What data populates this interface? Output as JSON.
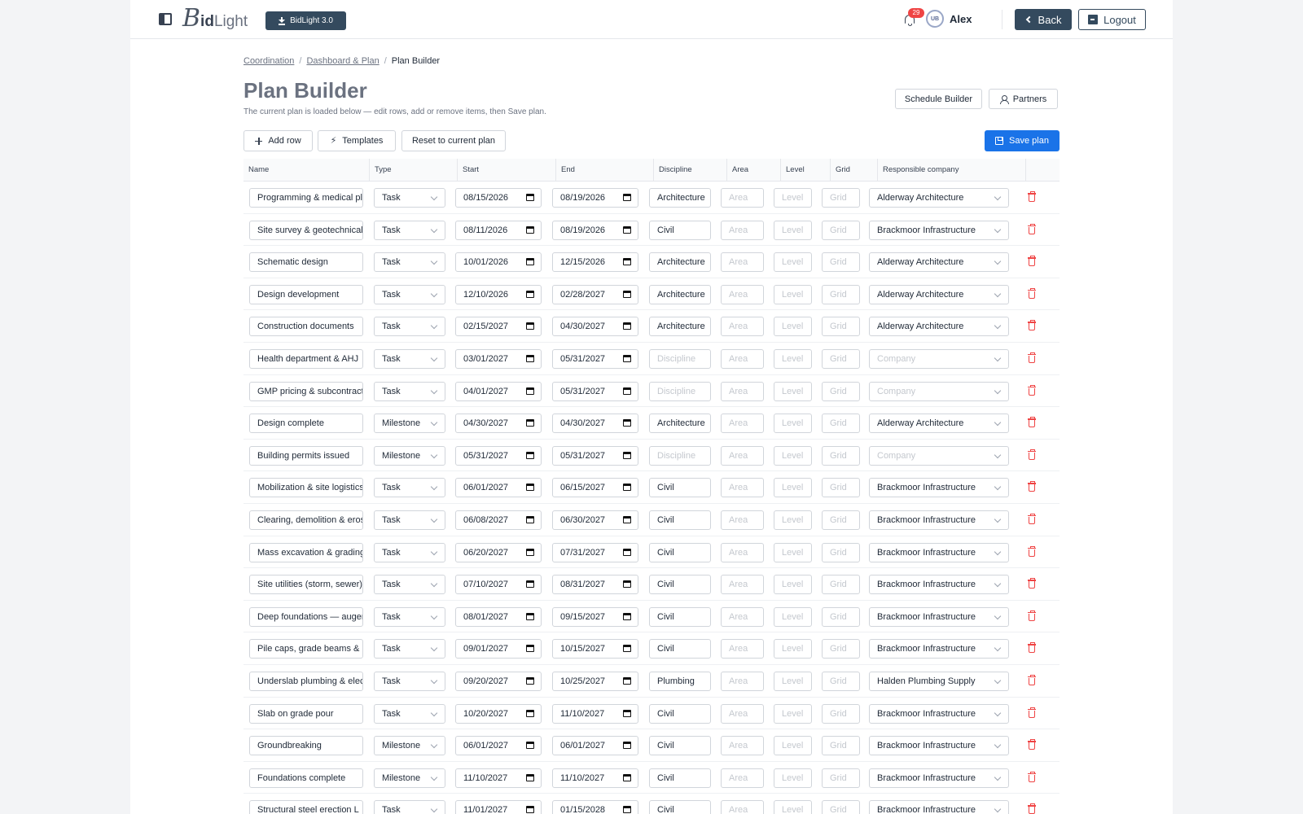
{
  "header": {
    "logo": {
      "b": "B",
      "id": "id",
      "light": "Light"
    },
    "download_label": "BidLight 3.0",
    "notifications_count": "29",
    "avatar_initials": "UB",
    "username": "Alex",
    "back_label": "Back",
    "logout_label": "Logout"
  },
  "breadcrumb": {
    "items": [
      "Coordination",
      "Dashboard & Plan"
    ],
    "current": "Plan Builder"
  },
  "page": {
    "title": "Plan Builder",
    "subtitle": "The current plan is loaded below — edit rows, add or remove items, then Save plan.",
    "schedule_builder_label": "Schedule Builder",
    "partners_label": "Partners"
  },
  "toolbar": {
    "add_row_label": "Add row",
    "templates_label": "Templates",
    "reset_label": "Reset to current plan",
    "save_label": "Save plan"
  },
  "table": {
    "columns": [
      "Name",
      "Type",
      "Start",
      "End",
      "Discipline",
      "Area",
      "Level",
      "Grid",
      "Responsible company"
    ],
    "placeholders": {
      "discipline": "Discipline",
      "area": "Area",
      "level": "Level",
      "grid": "Grid",
      "company": "Company"
    },
    "rows": [
      {
        "name": "Programming & medical planning",
        "type": "Task",
        "start": "08/15/2026",
        "end": "08/19/2026",
        "discipline": "Architecture",
        "company": "Alderway Architecture"
      },
      {
        "name": "Site survey & geotechnical",
        "type": "Task",
        "start": "08/11/2026",
        "end": "08/19/2026",
        "discipline": "Civil",
        "company": "Brackmoor Infrastructure"
      },
      {
        "name": "Schematic design",
        "type": "Task",
        "start": "10/01/2026",
        "end": "12/15/2026",
        "discipline": "Architecture",
        "company": "Alderway Architecture"
      },
      {
        "name": "Design development",
        "type": "Task",
        "start": "12/10/2026",
        "end": "02/28/2027",
        "discipline": "Architecture",
        "company": "Alderway Architecture"
      },
      {
        "name": "Construction documents",
        "type": "Task",
        "start": "02/15/2027",
        "end": "04/30/2027",
        "discipline": "Architecture",
        "company": "Alderway Architecture"
      },
      {
        "name": "Health department & AHJ",
        "type": "Task",
        "start": "03/01/2027",
        "end": "05/31/2027",
        "discipline": "",
        "company": ""
      },
      {
        "name": "GMP pricing & subcontracts",
        "type": "Task",
        "start": "04/01/2027",
        "end": "05/31/2027",
        "discipline": "",
        "company": ""
      },
      {
        "name": "Design complete",
        "type": "Milestone",
        "start": "04/30/2027",
        "end": "04/30/2027",
        "discipline": "Architecture",
        "company": "Alderway Architecture"
      },
      {
        "name": "Building permits issued",
        "type": "Milestone",
        "start": "05/31/2027",
        "end": "05/31/2027",
        "discipline": "",
        "company": ""
      },
      {
        "name": "Mobilization & site logistics",
        "type": "Task",
        "start": "06/01/2027",
        "end": "06/15/2027",
        "discipline": "Civil",
        "company": "Brackmoor Infrastructure"
      },
      {
        "name": "Clearing, demolition & erosion",
        "type": "Task",
        "start": "06/08/2027",
        "end": "06/30/2027",
        "discipline": "Civil",
        "company": "Brackmoor Infrastructure"
      },
      {
        "name": "Mass excavation & grading",
        "type": "Task",
        "start": "06/20/2027",
        "end": "07/31/2027",
        "discipline": "Civil",
        "company": "Brackmoor Infrastructure"
      },
      {
        "name": "Site utilities (storm, sewer)",
        "type": "Task",
        "start": "07/10/2027",
        "end": "08/31/2027",
        "discipline": "Civil",
        "company": "Brackmoor Infrastructure"
      },
      {
        "name": "Deep foundations — auger piles",
        "type": "Task",
        "start": "08/01/2027",
        "end": "09/15/2027",
        "discipline": "Civil",
        "company": "Brackmoor Infrastructure"
      },
      {
        "name": "Pile caps, grade beams & piers",
        "type": "Task",
        "start": "09/01/2027",
        "end": "10/15/2027",
        "discipline": "Civil",
        "company": "Brackmoor Infrastructure"
      },
      {
        "name": "Underslab plumbing & electrical",
        "type": "Task",
        "start": "09/20/2027",
        "end": "10/25/2027",
        "discipline": "Plumbing",
        "company": "Halden Plumbing Supply"
      },
      {
        "name": "Slab on grade pour",
        "type": "Task",
        "start": "10/20/2027",
        "end": "11/10/2027",
        "discipline": "Civil",
        "company": "Brackmoor Infrastructure"
      },
      {
        "name": "Groundbreaking",
        "type": "Milestone",
        "start": "06/01/2027",
        "end": "06/01/2027",
        "discipline": "Civil",
        "company": "Brackmoor Infrastructure"
      },
      {
        "name": "Foundations complete",
        "type": "Milestone",
        "start": "11/10/2027",
        "end": "11/10/2027",
        "discipline": "Civil",
        "company": "Brackmoor Infrastructure"
      },
      {
        "name": "Structural steel erection L",
        "type": "Task",
        "start": "11/01/2027",
        "end": "01/15/2028",
        "discipline": "Civil",
        "company": "Brackmoor Infrastructure"
      }
    ]
  },
  "colors": {
    "primary_dark": "#344a5e",
    "save_blue": "#1a73e8",
    "danger": "#ef4444"
  }
}
